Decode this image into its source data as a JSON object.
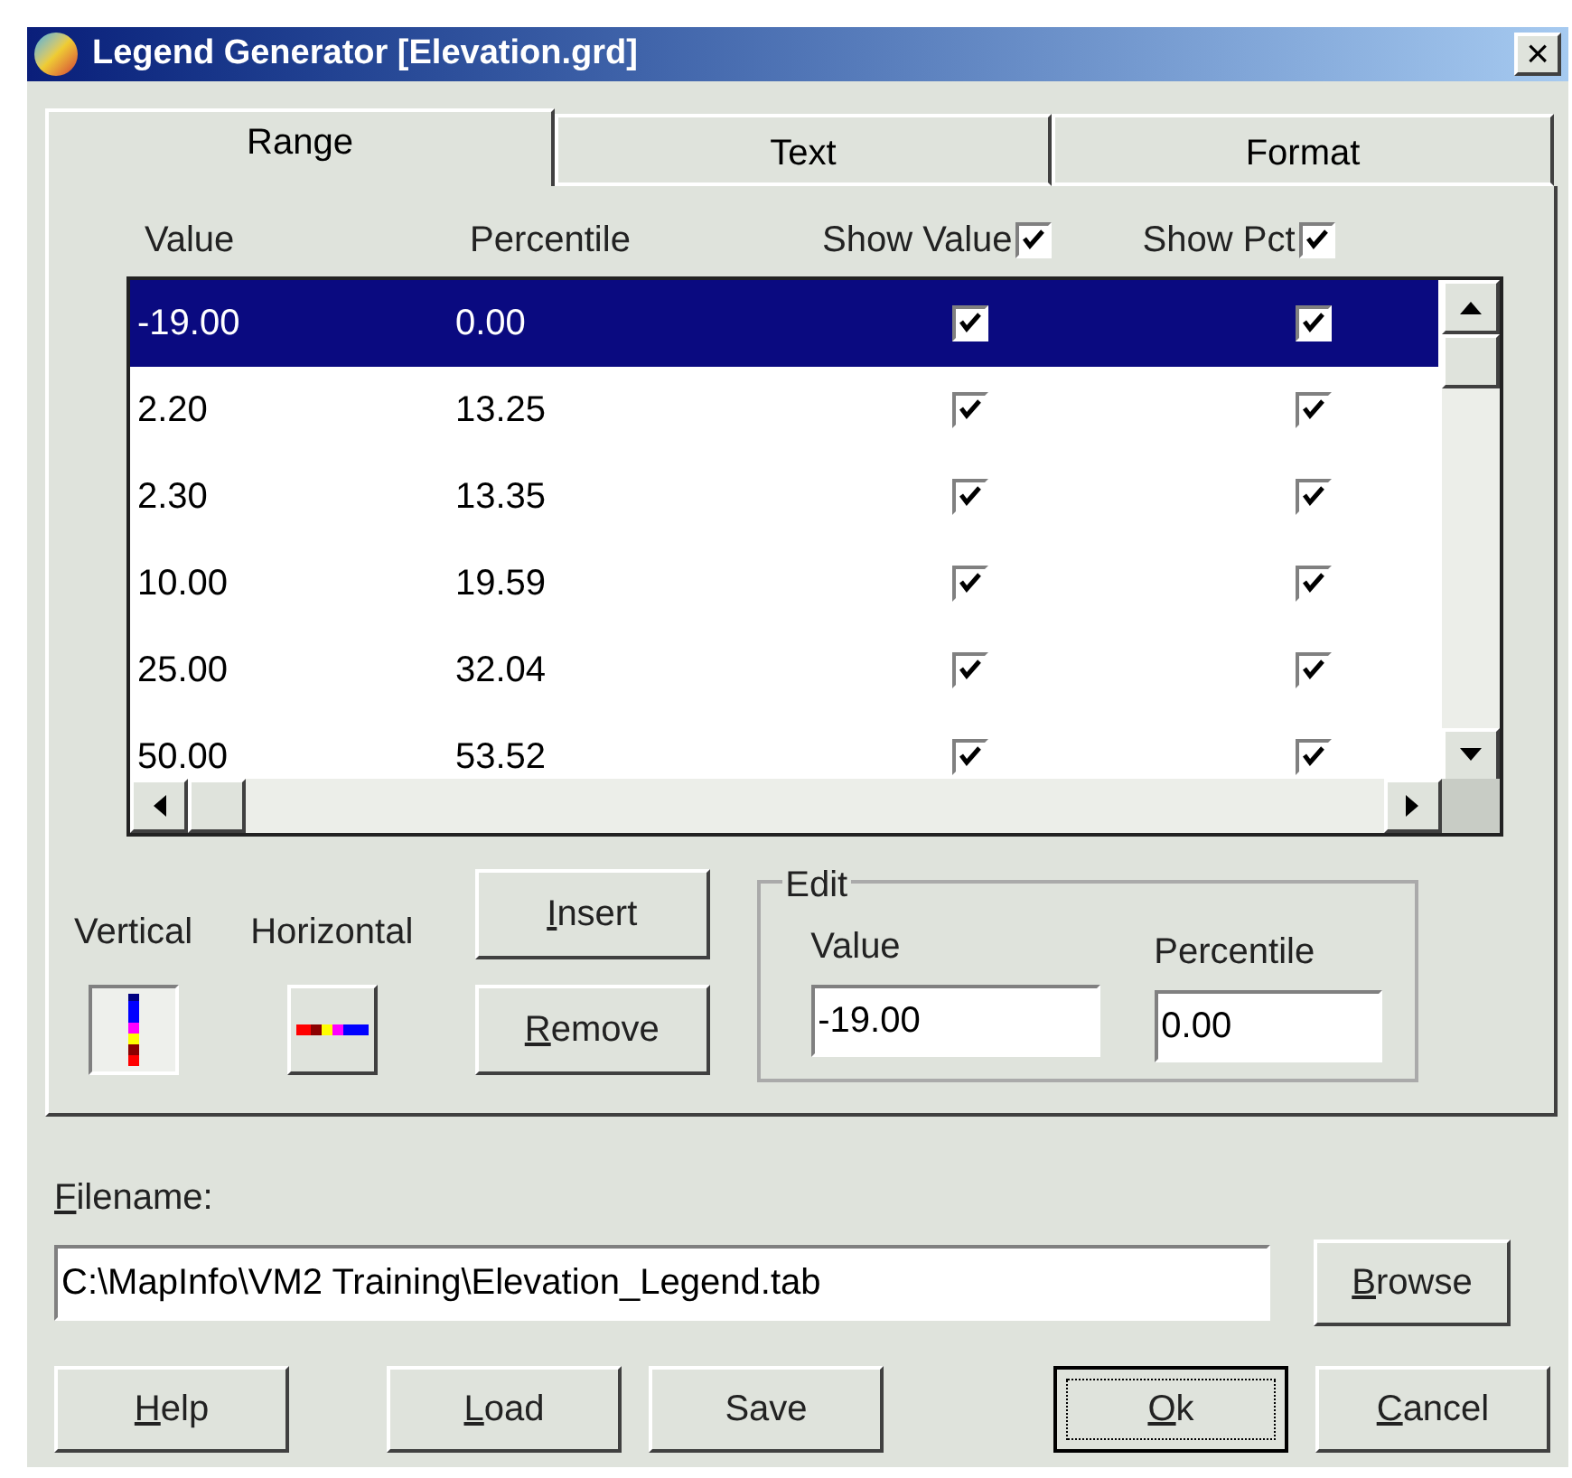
{
  "window": {
    "title": "Legend Generator [Elevation.grd]",
    "close": "×"
  },
  "tabs": [
    {
      "label": "Range",
      "selected": true
    },
    {
      "label": "Text",
      "selected": false
    },
    {
      "label": "Format",
      "selected": false
    }
  ],
  "table": {
    "columns": [
      {
        "label": "Value"
      },
      {
        "label": "Percentile"
      },
      {
        "label": "Show Value",
        "checked": true
      },
      {
        "label": "Show Pct",
        "checked": true
      }
    ],
    "rows": [
      {
        "value": "-19.00",
        "percentile": "0.00",
        "show_value": true,
        "show_pct": true,
        "selected": true
      },
      {
        "value": "2.20",
        "percentile": "13.25",
        "show_value": true,
        "show_pct": true,
        "selected": false
      },
      {
        "value": "2.30",
        "percentile": "13.35",
        "show_value": true,
        "show_pct": true,
        "selected": false
      },
      {
        "value": "10.00",
        "percentile": "19.59",
        "show_value": true,
        "show_pct": true,
        "selected": false
      },
      {
        "value": "25.00",
        "percentile": "32.04",
        "show_value": true,
        "show_pct": true,
        "selected": false
      },
      {
        "value": "50.00",
        "percentile": "53.52",
        "show_value": true,
        "show_pct": true,
        "selected": false
      }
    ]
  },
  "orientation": [
    {
      "label": "Vertical",
      "selected": true
    },
    {
      "label": "Horizontal",
      "selected": false
    }
  ],
  "row_buttons": [
    {
      "underlined": "I",
      "rest": "nsert"
    },
    {
      "underlined": "R",
      "rest": "emove"
    }
  ],
  "edit": {
    "title": "Edit",
    "fields": [
      {
        "label": "Value",
        "value": "-19.00"
      },
      {
        "label": "Percentile",
        "value": "0.00"
      }
    ]
  },
  "filename": {
    "label_underlined": "F",
    "label_rest": "ilename:",
    "value": "C:\\MapInfo\\VM2 Training\\Elevation_Legend.tab",
    "browse": {
      "underlined": "B",
      "rest": "rowse"
    }
  },
  "buttons": [
    {
      "underlined": "H",
      "rest": "elp",
      "default": false
    },
    {
      "underlined": "L",
      "rest": "oad",
      "default": false
    },
    {
      "rest": "Save",
      "default": false
    },
    {
      "underlined": "O",
      "rest": "k",
      "default": true
    },
    {
      "underlined": "C",
      "rest": "ancel",
      "default": false
    }
  ]
}
